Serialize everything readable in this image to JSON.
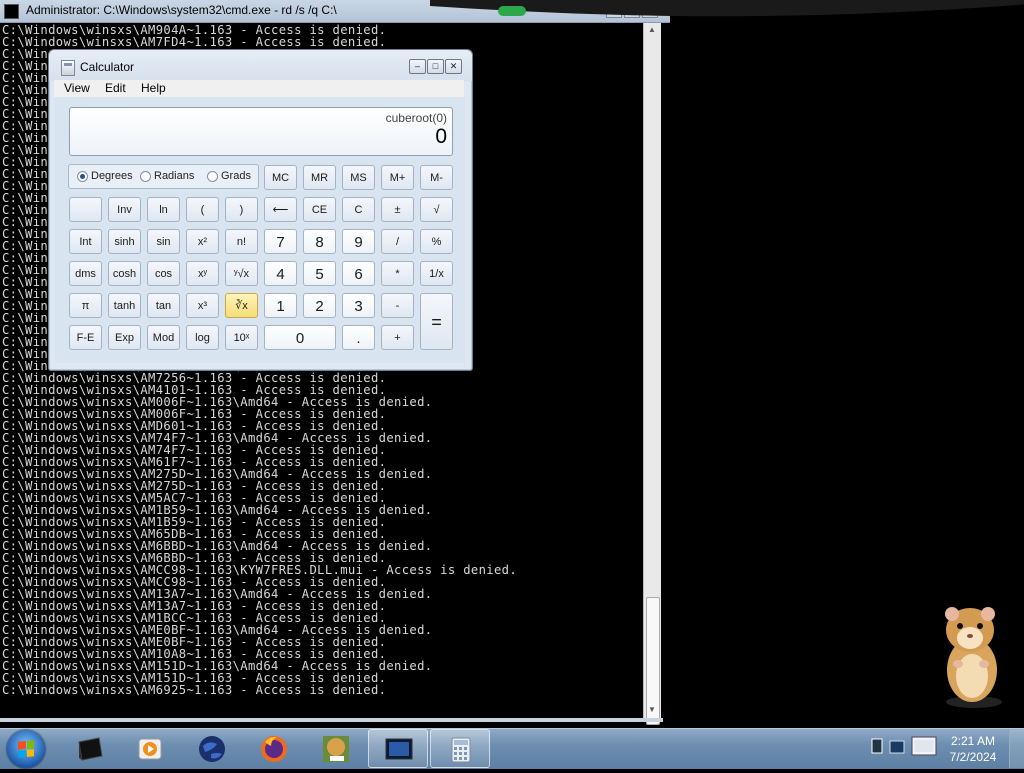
{
  "cmd": {
    "title": "Administrator: C:\\Windows\\system32\\cmd.exe - rd  /s /q C:\\",
    "lines": [
      "C:\\Windows\\winsxs\\AM904A~1.163 - Access is denied.",
      "C:\\Windows\\winsxs\\AM7FD4~1.163 - Access is denied.",
      "C:\\Win",
      "C:\\Win",
      "C:\\Win",
      "C:\\Win",
      "C:\\Win",
      "C:\\Win",
      "C:\\Win",
      "C:\\Win",
      "C:\\Win",
      "C:\\Win",
      "C:\\Win",
      "C:\\Win",
      "C:\\Win",
      "C:\\Win",
      "C:\\Win",
      "C:\\Win",
      "C:\\Win",
      "C:\\Win",
      "C:\\Win",
      "C:\\Win",
      "C:\\Win",
      "C:\\Win",
      "C:\\Win",
      "C:\\Win",
      "C:\\Win",
      "C:\\Win",
      "C:\\Windows\\winsxs\\AM7256~1.163\\Amd64 - Access is denied.",
      "C:\\Windows\\winsxs\\AM7256~1.163 - Access is denied.",
      "C:\\Windows\\winsxs\\AM4101~1.163 - Access is denied.",
      "C:\\Windows\\winsxs\\AM006F~1.163\\Amd64 - Access is denied.",
      "C:\\Windows\\winsxs\\AM006F~1.163 - Access is denied.",
      "C:\\Windows\\winsxs\\AMD601~1.163 - Access is denied.",
      "C:\\Windows\\winsxs\\AM74F7~1.163\\Amd64 - Access is denied.",
      "C:\\Windows\\winsxs\\AM74F7~1.163 - Access is denied.",
      "C:\\Windows\\winsxs\\AM61F7~1.163 - Access is denied.",
      "C:\\Windows\\winsxs\\AM275D~1.163\\Amd64 - Access is denied.",
      "C:\\Windows\\winsxs\\AM275D~1.163 - Access is denied.",
      "C:\\Windows\\winsxs\\AM5AC7~1.163 - Access is denied.",
      "C:\\Windows\\winsxs\\AM1B59~1.163\\Amd64 - Access is denied.",
      "C:\\Windows\\winsxs\\AM1B59~1.163 - Access is denied.",
      "C:\\Windows\\winsxs\\AM65DB~1.163 - Access is denied.",
      "C:\\Windows\\winsxs\\AM6BBD~1.163\\Amd64 - Access is denied.",
      "C:\\Windows\\winsxs\\AM6BBD~1.163 - Access is denied.",
      "C:\\Windows\\winsxs\\AMCC98~1.163\\KYW7FRES.DLL.mui - Access is denied.",
      "C:\\Windows\\winsxs\\AMCC98~1.163 - Access is denied.",
      "C:\\Windows\\winsxs\\AM13A7~1.163\\Amd64 - Access is denied.",
      "C:\\Windows\\winsxs\\AM13A7~1.163 - Access is denied.",
      "C:\\Windows\\winsxs\\AM1BCC~1.163 - Access is denied.",
      "C:\\Windows\\winsxs\\AME0BF~1.163\\Amd64 - Access is denied.",
      "C:\\Windows\\winsxs\\AME0BF~1.163 - Access is denied.",
      "C:\\Windows\\winsxs\\AM10A8~1.163 - Access is denied.",
      "C:\\Windows\\winsxs\\AM151D~1.163\\Amd64 - Access is denied.",
      "C:\\Windows\\winsxs\\AM151D~1.163 - Access is denied.",
      "C:\\Windows\\winsxs\\AM6925~1.163 - Access is denied."
    ]
  },
  "calculator": {
    "title": "Calculator",
    "menu": [
      "View",
      "Edit",
      "Help"
    ],
    "display": {
      "expression": "cuberoot(0)",
      "value": "0"
    },
    "angle_modes": [
      "Degrees",
      "Radians",
      "Grads"
    ],
    "selected_angle": "Degrees",
    "memory_buttons": [
      "MC",
      "MR",
      "MS",
      "M+",
      "M-"
    ],
    "row1": [
      "",
      "Inv",
      "ln",
      "(",
      ")",
      "⟵",
      "CE",
      "C",
      "±",
      "√"
    ],
    "row2": [
      "Int",
      "sinh",
      "sin",
      "x²",
      "n!",
      "7",
      "8",
      "9",
      "/",
      "%"
    ],
    "row3": [
      "dms",
      "cosh",
      "cos",
      "xʸ",
      "ʸ√x",
      "4",
      "5",
      "6",
      "*",
      "1/x"
    ],
    "row4": [
      "π",
      "tanh",
      "tan",
      "x³",
      "∛x",
      "1",
      "2",
      "3",
      "-",
      "="
    ],
    "row5": [
      "F-E",
      "Exp",
      "Mod",
      "log",
      "10ˣ",
      "0",
      ".",
      "+"
    ],
    "highlighted_button": "∛x"
  },
  "taskbar": {
    "apps": [
      "terminal",
      "media-player",
      "globe",
      "firefox",
      "box-game",
      "monitor",
      "calculator"
    ],
    "clock_time": "2:21 AM",
    "clock_date": "7/2/2024"
  }
}
